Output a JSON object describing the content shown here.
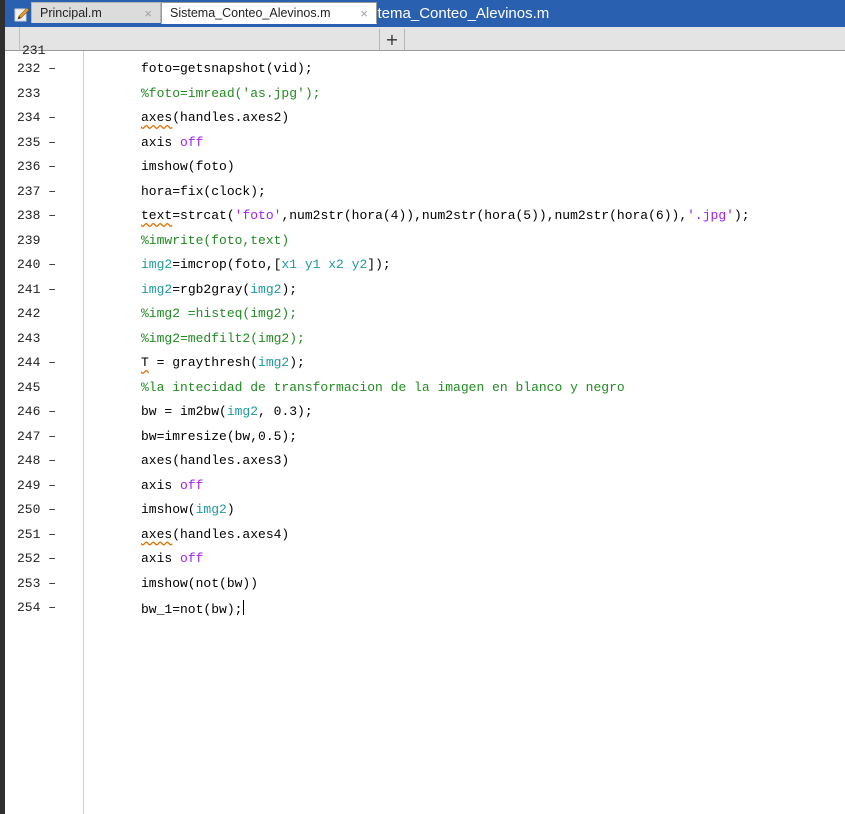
{
  "window": {
    "title": "Editor - C:\\Users\\JAVIER\\Desktop\\alevines final\\Sistema_Conteo_Alevinos.m",
    "icon": "pencil-edit-icon"
  },
  "tabs": [
    {
      "label": "Principal.m",
      "close": "×",
      "active": false
    },
    {
      "label": "Sistema_Conteo_Alevinos.m",
      "close": "×",
      "active": true
    }
  ],
  "add_tab": "+",
  "gutter_stub": "231",
  "lines": [
    {
      "num": "232 –",
      "parts": [
        [
          "foto=getsnapshot(vid);",
          ""
        ]
      ]
    },
    {
      "num": "233",
      "parts": [
        [
          "%foto=imread('as.jpg');",
          "com"
        ]
      ]
    },
    {
      "num": "234 –",
      "parts": [
        [
          "axes",
          "sq"
        ],
        [
          "(handles.axes2)",
          ""
        ]
      ]
    },
    {
      "num": "235 –",
      "parts": [
        [
          "axis ",
          ""
        ],
        [
          "off",
          "kw"
        ]
      ]
    },
    {
      "num": "236 –",
      "parts": [
        [
          "imshow(foto)",
          ""
        ]
      ]
    },
    {
      "num": "237 –",
      "parts": [
        [
          "hora=fix(clock);",
          ""
        ]
      ]
    },
    {
      "num": "238 –",
      "parts": [
        [
          "text",
          "sq"
        ],
        [
          "=strcat(",
          ""
        ],
        [
          "'foto'",
          "str"
        ],
        [
          ",num2str(hora(4)),num2str(hora(5)),num2str(hora(6)),",
          ""
        ],
        [
          "'.jpg'",
          "str"
        ],
        [
          ");",
          ""
        ]
      ]
    },
    {
      "num": "239",
      "parts": [
        [
          "%imwrite(foto,text)",
          "com"
        ]
      ]
    },
    {
      "num": "240 –",
      "parts": [
        [
          "img2",
          "var"
        ],
        [
          "=imcrop(foto,[",
          ""
        ],
        [
          "x1 y1 x2 y2",
          "var"
        ],
        [
          "]);",
          ""
        ]
      ]
    },
    {
      "num": "241 –",
      "parts": [
        [
          "img2",
          "var"
        ],
        [
          "=rgb2gray(",
          ""
        ],
        [
          "img2",
          "var"
        ],
        [
          ");",
          ""
        ]
      ]
    },
    {
      "num": "242",
      "parts": [
        [
          "%img2 =histeq(img2);",
          "com"
        ]
      ]
    },
    {
      "num": "243",
      "parts": [
        [
          "%img2=medfilt2(img2);",
          "com"
        ]
      ]
    },
    {
      "num": "244 –",
      "parts": [
        [
          "T",
          "sq"
        ],
        [
          " = graythresh(",
          ""
        ],
        [
          "img2",
          "var"
        ],
        [
          ");",
          ""
        ]
      ]
    },
    {
      "num": "245",
      "parts": [
        [
          "%la intecidad de transformacion de la imagen en blanco y negro",
          "com"
        ]
      ]
    },
    {
      "num": "246 –",
      "parts": [
        [
          "bw = im2bw(",
          ""
        ],
        [
          "img2",
          "var"
        ],
        [
          ", 0.3);",
          ""
        ]
      ]
    },
    {
      "num": "247 –",
      "parts": [
        [
          "bw=imresize(bw,0.5);",
          ""
        ]
      ]
    },
    {
      "num": "248 –",
      "parts": [
        [
          "axes(handles.axes3)",
          ""
        ]
      ]
    },
    {
      "num": "249 –",
      "parts": [
        [
          "axis ",
          ""
        ],
        [
          "off",
          "kw"
        ]
      ]
    },
    {
      "num": "250 –",
      "parts": [
        [
          "imshow(",
          ""
        ],
        [
          "img2",
          "var"
        ],
        [
          ")",
          ""
        ]
      ]
    },
    {
      "num": "251 –",
      "parts": [
        [
          "axes",
          "sq"
        ],
        [
          "(handles.axes4)",
          ""
        ]
      ]
    },
    {
      "num": "252 –",
      "parts": [
        [
          "axis ",
          ""
        ],
        [
          "off",
          "kw"
        ]
      ]
    },
    {
      "num": "253 –",
      "parts": [
        [
          "imshow(not(bw))",
          ""
        ]
      ]
    },
    {
      "num": "254 –",
      "parts": [
        [
          "bw_1=not(bw);",
          ""
        ]
      ]
    }
  ]
}
